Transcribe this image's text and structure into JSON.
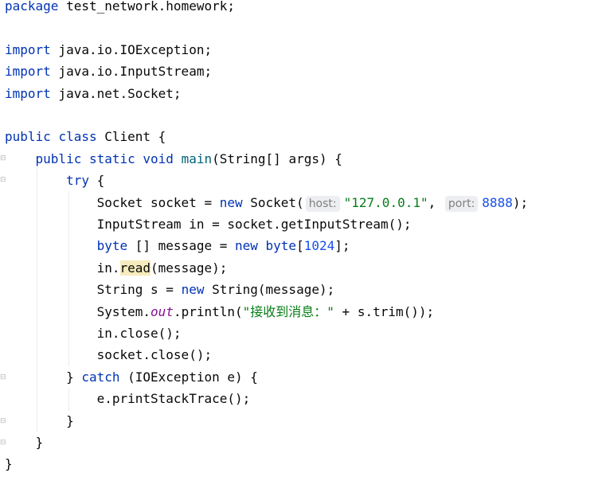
{
  "editor": {
    "lines": [
      {
        "tokens": [
          {
            "t": "package",
            "c": "kw"
          },
          {
            "t": " test_network.homework;"
          }
        ]
      },
      {
        "tokens": []
      },
      {
        "tokens": [
          {
            "t": "import",
            "c": "kw"
          },
          {
            "t": " java.io.IOException;"
          }
        ]
      },
      {
        "tokens": [
          {
            "t": "import",
            "c": "kw"
          },
          {
            "t": " java.io.InputStream;"
          }
        ]
      },
      {
        "tokens": [
          {
            "t": "import",
            "c": "kw"
          },
          {
            "t": " java.net.Socket;"
          }
        ]
      },
      {
        "tokens": []
      },
      {
        "tokens": [
          {
            "t": "public",
            "c": "kw"
          },
          {
            "t": " "
          },
          {
            "t": "class",
            "c": "kw"
          },
          {
            "t": " Client {"
          }
        ]
      },
      {
        "tokens": [
          {
            "t": "    "
          },
          {
            "t": "public",
            "c": "kw"
          },
          {
            "t": " "
          },
          {
            "t": "static",
            "c": "kw"
          },
          {
            "t": " "
          },
          {
            "t": "void",
            "c": "kw"
          },
          {
            "t": " "
          },
          {
            "t": "main",
            "c": "fn"
          },
          {
            "t": "(String[] args) {"
          }
        ]
      },
      {
        "tokens": [
          {
            "t": "        "
          },
          {
            "t": "try",
            "c": "kw"
          },
          {
            "t": " {"
          }
        ]
      },
      {
        "tokens": [
          {
            "t": "            Socket socket = "
          },
          {
            "t": "new",
            "c": "kw"
          },
          {
            "t": " Socket("
          },
          {
            "t": "host:",
            "c": "hint"
          },
          {
            "t": "\"127.0.0.1\"",
            "c": "str"
          },
          {
            "t": ", "
          },
          {
            "t": "port:",
            "c": "hint"
          },
          {
            "t": "8888",
            "c": "num"
          },
          {
            "t": ");"
          }
        ]
      },
      {
        "tokens": [
          {
            "t": "            InputStream in = socket.getInputStream();"
          }
        ]
      },
      {
        "tokens": [
          {
            "t": "            "
          },
          {
            "t": "byte",
            "c": "kw"
          },
          {
            "t": " [] message = "
          },
          {
            "t": "new",
            "c": "kw"
          },
          {
            "t": " "
          },
          {
            "t": "byte",
            "c": "kw"
          },
          {
            "t": "["
          },
          {
            "t": "1024",
            "c": "num"
          },
          {
            "t": "];"
          }
        ]
      },
      {
        "tokens": [
          {
            "t": "            in."
          },
          {
            "t": "read",
            "c": "hl"
          },
          {
            "t": "(message);"
          }
        ]
      },
      {
        "tokens": [
          {
            "t": "            String s = "
          },
          {
            "t": "new",
            "c": "kw"
          },
          {
            "t": " String(message);"
          }
        ]
      },
      {
        "tokens": [
          {
            "t": "            System."
          },
          {
            "t": "out",
            "c": "field"
          },
          {
            "t": ".println("
          },
          {
            "t": "\"接收到消息：\"",
            "c": "str"
          },
          {
            "t": " + s.trim());"
          }
        ]
      },
      {
        "tokens": [
          {
            "t": "            in.close();"
          }
        ]
      },
      {
        "tokens": [
          {
            "t": "            socket.close();"
          }
        ]
      },
      {
        "tokens": [
          {
            "t": "        } "
          },
          {
            "t": "catch",
            "c": "kw"
          },
          {
            "t": " (IOException e) {"
          }
        ]
      },
      {
        "tokens": [
          {
            "t": "            e.printStackTrace();"
          }
        ]
      },
      {
        "tokens": [
          {
            "t": "        }"
          }
        ]
      },
      {
        "tokens": [
          {
            "t": "    }"
          }
        ]
      },
      {
        "tokens": [
          {
            "t": "}"
          }
        ]
      }
    ]
  },
  "gutter": {
    "fold_icon": "fold-marker-icon"
  }
}
